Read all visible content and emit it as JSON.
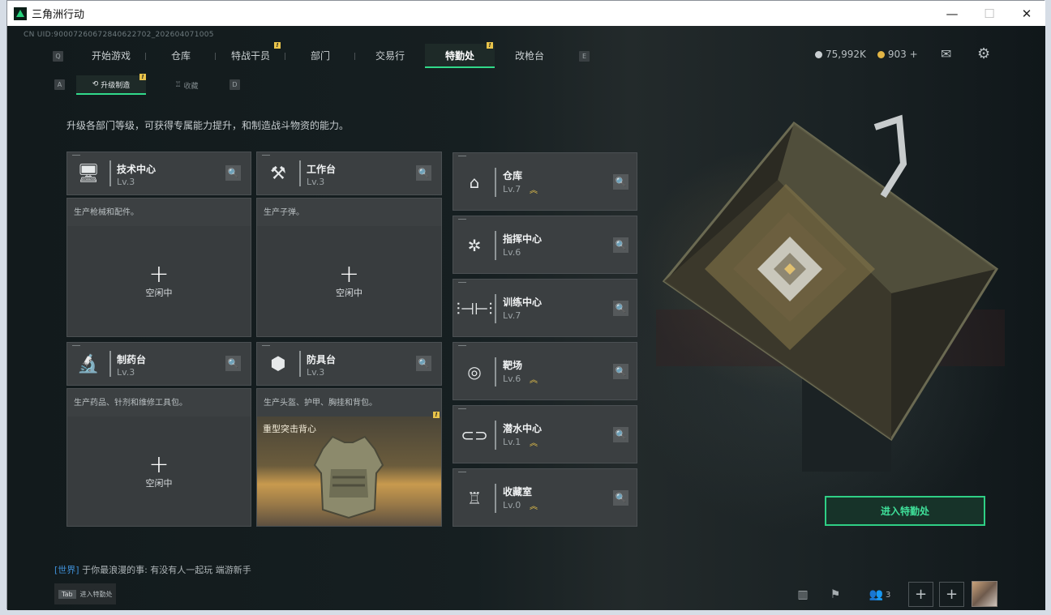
{
  "window": {
    "title": "三角洲行动",
    "minimize_glyph": "—",
    "maximize_glyph": "☐",
    "close_glyph": "✕"
  },
  "uid_text": "CN UID:9000726067284062270​2_202604071005",
  "nav": {
    "left_key": "Q",
    "right_key": "E",
    "tabs": [
      {
        "label": "开始游戏"
      },
      {
        "label": "仓库"
      },
      {
        "label": "特战干员",
        "badge": "!"
      },
      {
        "label": "部门"
      },
      {
        "label": "交易行"
      },
      {
        "label": "特勤处",
        "badge": "!",
        "active": true
      },
      {
        "label": "改枪台"
      }
    ]
  },
  "hud": {
    "currency1": "75,992K",
    "currency2": "903 +",
    "currency1_color": "#c9ced1",
    "currency2_color": "#e2b545",
    "mail_icon": "mail-icon",
    "settings_icon": "gear-icon"
  },
  "subnav": {
    "left_key": "A",
    "right_key": "D",
    "tab1": "升级制造",
    "tab1_badge": "!",
    "tab2": "收藏"
  },
  "description": "升级各部门等级，可获得专属能力提升，和制造战斗物资的能力。",
  "left_cards": [
    {
      "name": "技术中心",
      "level": "Lv.3",
      "desc": "生产枪械和配件。",
      "status": "空闲中",
      "icon": "computer-icon"
    },
    {
      "name": "工作台",
      "level": "Lv.3",
      "desc": "生产子弹。",
      "status": "空闲中",
      "icon": "tools-icon"
    },
    {
      "name": "制药台",
      "level": "Lv.3",
      "desc": "生产药品、针剂和维修工具包。",
      "status": "空闲中",
      "icon": "microscope-icon"
    },
    {
      "name": "防具台",
      "level": "Lv.3",
      "desc": "生产头盔、护甲、胸挂和背包。",
      "crafting": "重型突击背心",
      "craft_badge": "!",
      "icon": "cubes-icon"
    }
  ],
  "right_cards": [
    {
      "name": "仓库",
      "level": "Lv.7",
      "upgrade": "︽",
      "icon": "warehouse-icon"
    },
    {
      "name": "指挥中心",
      "level": "Lv.6",
      "upgrade": "",
      "icon": "command-icon"
    },
    {
      "name": "训练中心",
      "level": "Lv.7",
      "upgrade": "",
      "icon": "dumbbell-icon"
    },
    {
      "name": "靶场",
      "level": "Lv.6",
      "upgrade": "︽",
      "icon": "target-icon"
    },
    {
      "name": "潜水中心",
      "level": "Lv.1",
      "upgrade": "︽",
      "icon": "goggles-icon"
    },
    {
      "name": "收藏室",
      "level": "Lv.0",
      "upgrade": "︽",
      "icon": "trophy-icon"
    }
  ],
  "enter_button": "进入特勤处",
  "chat": {
    "channel": "[世界]",
    "message": " 于你最浪漫的事: 有没有人一起玩  端游新手"
  },
  "tab_hint": {
    "key": "Tab",
    "label": "进入特勤处"
  },
  "bottom_bar": {
    "friends_count": "3",
    "plus_glyph": "+"
  }
}
